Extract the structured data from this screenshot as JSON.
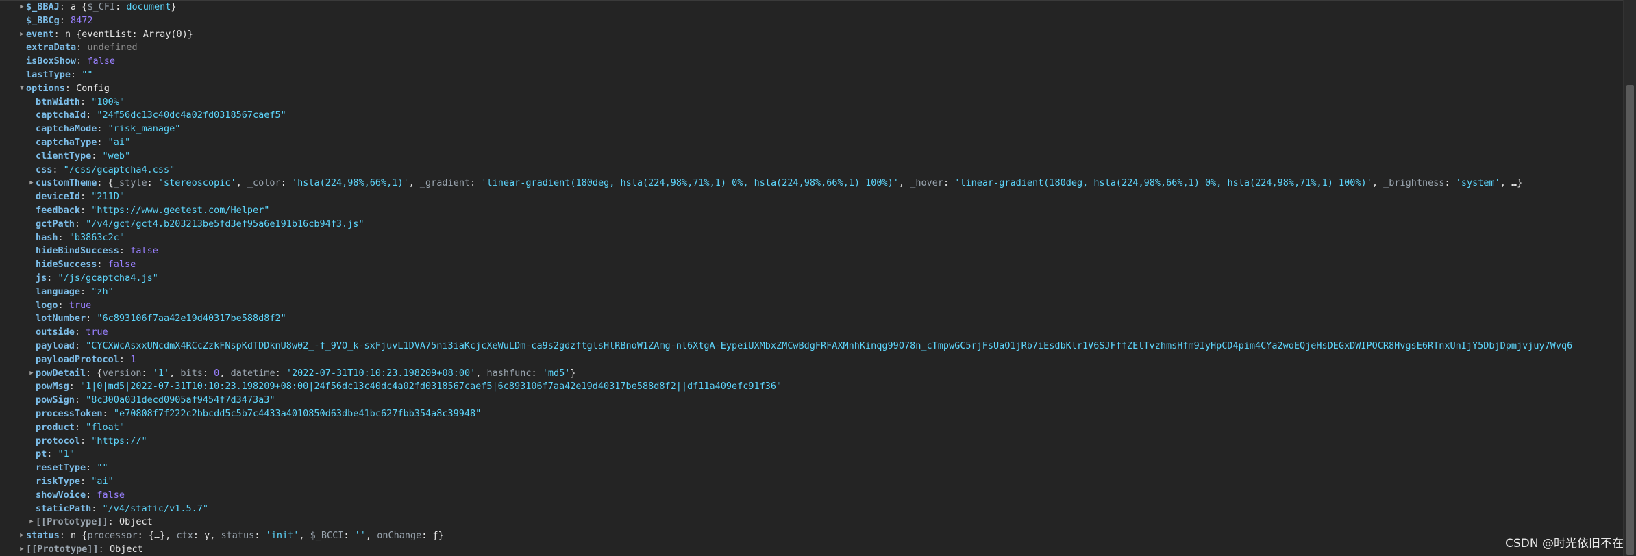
{
  "rows": [
    {
      "indent": 38,
      "tri": "▶",
      "key": "$_BBAJ",
      "parts": [
        [
          "plain",
          "a {"
        ],
        [
          "inner-key",
          "$_CFI"
        ],
        [
          "plain",
          ": "
        ],
        [
          "cls",
          "document"
        ],
        [
          "plain",
          "}"
        ]
      ]
    },
    {
      "indent": 38,
      "tri": "",
      "key": "$_BBCg",
      "parts": [
        [
          "num",
          "8472"
        ]
      ]
    },
    {
      "indent": 38,
      "tri": "▶",
      "key": "event",
      "parts": [
        [
          "plain",
          "n {"
        ],
        [
          "plain",
          "eventList"
        ],
        [
          "plain",
          ": Array(0)}"
        ]
      ]
    },
    {
      "indent": 38,
      "tri": "",
      "key": "extraData",
      "parts": [
        [
          "undef",
          "undefined"
        ]
      ]
    },
    {
      "indent": 38,
      "tri": "",
      "key": "isBoxShow",
      "parts": [
        [
          "bool",
          "false"
        ]
      ]
    },
    {
      "indent": 38,
      "tri": "",
      "key": "lastType",
      "parts": [
        [
          "str",
          "\"\""
        ]
      ]
    },
    {
      "indent": 38,
      "tri": "▼",
      "key": "options",
      "parts": [
        [
          "plain",
          "Config"
        ]
      ]
    },
    {
      "indent": 52,
      "tri": "",
      "key": "btnWidth",
      "parts": [
        [
          "str",
          "\"100%\""
        ]
      ]
    },
    {
      "indent": 52,
      "tri": "",
      "key": "captchaId",
      "parts": [
        [
          "str",
          "\"24f56dc13c40dc4a02fd0318567caef5\""
        ]
      ]
    },
    {
      "indent": 52,
      "tri": "",
      "key": "captchaMode",
      "parts": [
        [
          "str",
          "\"risk_manage\""
        ]
      ]
    },
    {
      "indent": 52,
      "tri": "",
      "key": "captchaType",
      "parts": [
        [
          "str",
          "\"ai\""
        ]
      ]
    },
    {
      "indent": 52,
      "tri": "",
      "key": "clientType",
      "parts": [
        [
          "str",
          "\"web\""
        ]
      ]
    },
    {
      "indent": 52,
      "tri": "",
      "key": "css",
      "parts": [
        [
          "str",
          "\"/css/gcaptcha4.css\""
        ]
      ]
    },
    {
      "indent": 52,
      "tri": "▶",
      "key": "customTheme",
      "parts": [
        [
          "plain",
          "{"
        ],
        [
          "inner-key",
          "_style"
        ],
        [
          "plain",
          ": "
        ],
        [
          "inner-str",
          "'stereoscopic'"
        ],
        [
          "plain",
          ", "
        ],
        [
          "inner-key",
          "_color"
        ],
        [
          "plain",
          ": "
        ],
        [
          "inner-str",
          "'hsla(224,98%,66%,1)'"
        ],
        [
          "plain",
          ", "
        ],
        [
          "inner-key",
          "_gradient"
        ],
        [
          "plain",
          ": "
        ],
        [
          "inner-str",
          "'linear-gradient(180deg, hsla(224,98%,71%,1) 0%, hsla(224,98%,66%,1) 100%)'"
        ],
        [
          "plain",
          ", "
        ],
        [
          "inner-key",
          "_hover"
        ],
        [
          "plain",
          ": "
        ],
        [
          "inner-str",
          "'linear-gradient(180deg, hsla(224,98%,66%,1) 0%, hsla(224,98%,71%,1) 100%)'"
        ],
        [
          "plain",
          ", "
        ],
        [
          "inner-key",
          "_brightness"
        ],
        [
          "plain",
          ": "
        ],
        [
          "inner-str",
          "'system'"
        ],
        [
          "plain",
          ", …}"
        ]
      ]
    },
    {
      "indent": 52,
      "tri": "",
      "key": "deviceId",
      "parts": [
        [
          "str",
          "\"211D\""
        ]
      ]
    },
    {
      "indent": 52,
      "tri": "",
      "key": "feedback",
      "parts": [
        [
          "str",
          "\"https://www.geetest.com/Helper\""
        ]
      ]
    },
    {
      "indent": 52,
      "tri": "",
      "key": "gctPath",
      "parts": [
        [
          "str",
          "\"/v4/gct/gct4.b203213be5fd3ef95a6e191b16cb94f3.js\""
        ]
      ]
    },
    {
      "indent": 52,
      "tri": "",
      "key": "hash",
      "parts": [
        [
          "str",
          "\"b3863c2c\""
        ]
      ]
    },
    {
      "indent": 52,
      "tri": "",
      "key": "hideBindSuccess",
      "parts": [
        [
          "bool",
          "false"
        ]
      ]
    },
    {
      "indent": 52,
      "tri": "",
      "key": "hideSuccess",
      "parts": [
        [
          "bool",
          "false"
        ]
      ]
    },
    {
      "indent": 52,
      "tri": "",
      "key": "js",
      "parts": [
        [
          "str",
          "\"/js/gcaptcha4.js\""
        ]
      ]
    },
    {
      "indent": 52,
      "tri": "",
      "key": "language",
      "parts": [
        [
          "str",
          "\"zh\""
        ]
      ]
    },
    {
      "indent": 52,
      "tri": "",
      "key": "logo",
      "parts": [
        [
          "bool",
          "true"
        ]
      ]
    },
    {
      "indent": 52,
      "tri": "",
      "key": "lotNumber",
      "parts": [
        [
          "str",
          "\"6c893106f7aa42e19d40317be588d8f2\""
        ]
      ]
    },
    {
      "indent": 52,
      "tri": "",
      "key": "outside",
      "parts": [
        [
          "bool",
          "true"
        ]
      ]
    },
    {
      "indent": 52,
      "tri": "",
      "key": "payload",
      "parts": [
        [
          "str",
          "\"CYCXWcAsxxUNcdmX4RCcZzkFNspKdTDDknU8w02_-f_9VO_k-sxFjuvL1DVA75ni3iaKcjcXeWuLDm-ca9s2gdzftglsHlRBnoW1ZAmg-nl6XtgA-EypeiUXMbxZMCwBdgFRFAXMnhKinqg99O78n_cTmpwGC5rjFsUaO1jRb7iEsdbKlr1V6SJFffZElTvzhmsHfm9IyHpCD4pim4CYa2woEQjeHsDEGxDWIPOCR8HvgsE6RTnxUnIjY5DbjDpmjvjuy7Wvq6"
        ]
      ]
    },
    {
      "indent": 52,
      "tri": "",
      "key": "payloadProtocol",
      "parts": [
        [
          "num",
          "1"
        ]
      ]
    },
    {
      "indent": 52,
      "tri": "▶",
      "key": "powDetail",
      "parts": [
        [
          "plain",
          "{"
        ],
        [
          "inner-key",
          "version"
        ],
        [
          "plain",
          ": "
        ],
        [
          "inner-str",
          "'1'"
        ],
        [
          "plain",
          ", "
        ],
        [
          "inner-key",
          "bits"
        ],
        [
          "plain",
          ": "
        ],
        [
          "inner-num",
          "0"
        ],
        [
          "plain",
          ", "
        ],
        [
          "inner-key",
          "datetime"
        ],
        [
          "plain",
          ": "
        ],
        [
          "inner-str",
          "'2022-07-31T10:10:23.198209+08:00'"
        ],
        [
          "plain",
          ", "
        ],
        [
          "inner-key",
          "hashfunc"
        ],
        [
          "plain",
          ": "
        ],
        [
          "inner-str",
          "'md5'"
        ],
        [
          "plain",
          "}"
        ]
      ]
    },
    {
      "indent": 52,
      "tri": "",
      "key": "powMsg",
      "parts": [
        [
          "str",
          "\"1|0|md5|2022-07-31T10:10:23.198209+08:00|24f56dc13c40dc4a02fd0318567caef5|6c893106f7aa42e19d40317be588d8f2||df11a409efc91f36\""
        ]
      ]
    },
    {
      "indent": 52,
      "tri": "",
      "key": "powSign",
      "parts": [
        [
          "str",
          "\"8c300a031decd0905af9454f7d3473a3\""
        ]
      ]
    },
    {
      "indent": 52,
      "tri": "",
      "key": "processToken",
      "parts": [
        [
          "str",
          "\"e70808f7f222c2bbcdd5c5b7c4433a4010850d63dbe41bc627fbb354a8c39948\""
        ]
      ]
    },
    {
      "indent": 52,
      "tri": "",
      "key": "product",
      "parts": [
        [
          "str",
          "\"float\""
        ]
      ]
    },
    {
      "indent": 52,
      "tri": "",
      "key": "protocol",
      "parts": [
        [
          "str",
          "\"https://\""
        ]
      ]
    },
    {
      "indent": 52,
      "tri": "",
      "key": "pt",
      "parts": [
        [
          "str",
          "\"1\""
        ]
      ]
    },
    {
      "indent": 52,
      "tri": "",
      "key": "resetType",
      "parts": [
        [
          "str",
          "\"\""
        ]
      ]
    },
    {
      "indent": 52,
      "tri": "",
      "key": "riskType",
      "parts": [
        [
          "str",
          "\"ai\""
        ]
      ]
    },
    {
      "indent": 52,
      "tri": "",
      "key": "showVoice",
      "parts": [
        [
          "bool",
          "false"
        ]
      ]
    },
    {
      "indent": 52,
      "tri": "",
      "key": "staticPath",
      "parts": [
        [
          "str",
          "\"/v4/static/v1.5.7\""
        ]
      ]
    },
    {
      "indent": 52,
      "tri": "▶",
      "key": "[[Prototype]]",
      "dim": true,
      "parts": [
        [
          "plain",
          "Object"
        ]
      ]
    },
    {
      "indent": 38,
      "tri": "▶",
      "key": "status",
      "parts": [
        [
          "plain",
          "n {"
        ],
        [
          "inner-key",
          "processor"
        ],
        [
          "plain",
          ": {…}, "
        ],
        [
          "inner-key",
          "ctx"
        ],
        [
          "plain",
          ": y, "
        ],
        [
          "inner-key",
          "status"
        ],
        [
          "plain",
          ": "
        ],
        [
          "inner-str",
          "'init'"
        ],
        [
          "plain",
          ", "
        ],
        [
          "inner-key",
          "$_BCCI"
        ],
        [
          "plain",
          ": "
        ],
        [
          "inner-str",
          "''"
        ],
        [
          "plain",
          ", "
        ],
        [
          "inner-key",
          "onChange"
        ],
        [
          "plain",
          ": "
        ],
        [
          "plain",
          "ƒ}"
        ]
      ]
    },
    {
      "indent": 38,
      "tri": "▶",
      "key": "[[Prototype]]",
      "dim": true,
      "parts": [
        [
          "plain",
          "Object"
        ]
      ]
    }
  ],
  "watermark": "CSDN @时光依旧不在"
}
